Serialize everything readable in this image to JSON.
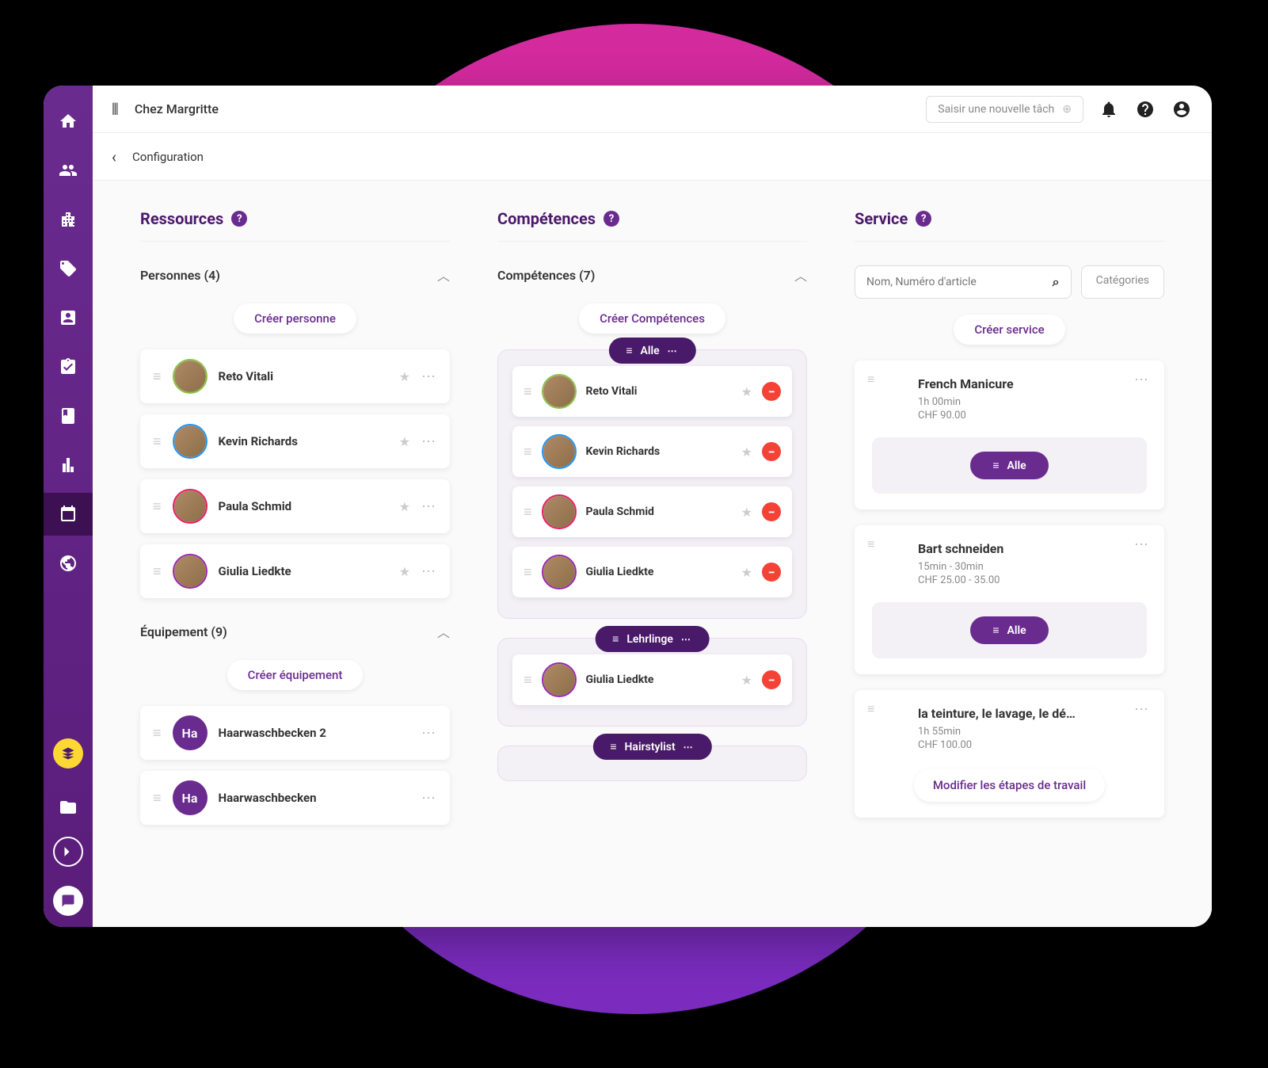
{
  "header": {
    "title": "Chez Margritte",
    "newTaskPlaceholder": "Saisir une nouvelle tâch"
  },
  "subheader": {
    "title": "Configuration"
  },
  "columns": {
    "resources": {
      "title": "Ressources",
      "sections": {
        "persons": {
          "label": "Personnes (4)",
          "createLabel": "Créer personne",
          "items": [
            {
              "name": "Reto Vitali",
              "ring": "green"
            },
            {
              "name": "Kevin Richards",
              "ring": "blue"
            },
            {
              "name": "Paula Schmid",
              "ring": "pink"
            },
            {
              "name": "Giulia Liedkte",
              "ring": "purple"
            }
          ]
        },
        "equipment": {
          "label": "Équipement (9)",
          "createLabel": "Créer équipement",
          "items": [
            {
              "name": "Haarwaschbecken 2",
              "initials": "Ha"
            },
            {
              "name": "Haarwaschbecken",
              "initials": "Ha"
            }
          ]
        }
      }
    },
    "skills": {
      "title": "Compétences",
      "section": {
        "label": "Compétences (7)",
        "createLabel": "Créer Compétences"
      },
      "groups": [
        {
          "name": "Alle",
          "members": [
            {
              "name": "Reto Vitali",
              "ring": "green"
            },
            {
              "name": "Kevin Richards",
              "ring": "blue"
            },
            {
              "name": "Paula Schmid",
              "ring": "pink"
            },
            {
              "name": "Giulia Liedkte",
              "ring": "purple"
            }
          ]
        },
        {
          "name": "Lehrlinge",
          "members": [
            {
              "name": "Giulia Liedkte",
              "ring": "purple"
            }
          ]
        },
        {
          "name": "Hairstylist",
          "members": []
        }
      ]
    },
    "services": {
      "title": "Service",
      "searchPlaceholder": "Nom, Numéro d'article",
      "categoriesLabel": "Catégories",
      "createLabel": "Créer service",
      "items": [
        {
          "title": "French Manicure",
          "duration": "1h 00min",
          "price": "CHF 90.00",
          "tag": "Alle"
        },
        {
          "title": "Bart schneiden",
          "duration": "15min - 30min",
          "price": "CHF 25.00 - 35.00",
          "tag": "Alle"
        },
        {
          "title": "la teinture, le lavage, le dé…",
          "duration": "1h 55min",
          "price": "CHF 100.00",
          "modifyLabel": "Modifier les étapes de travail"
        }
      ]
    }
  }
}
